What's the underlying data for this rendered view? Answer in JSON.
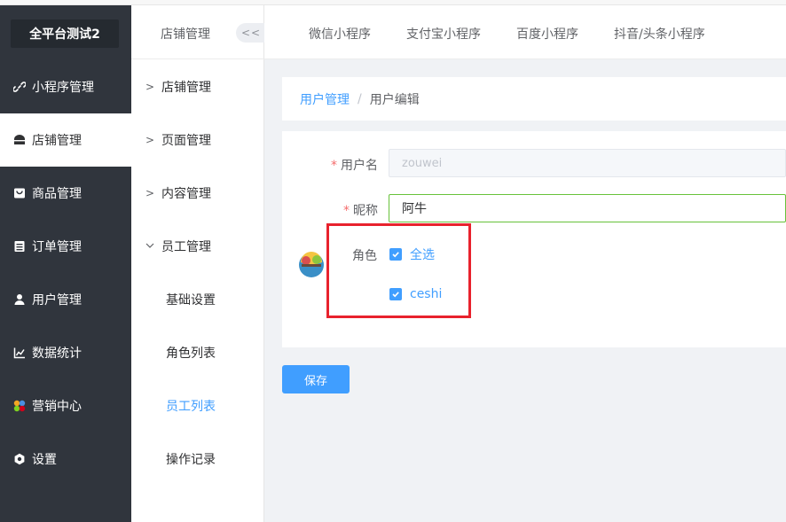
{
  "sidebar": {
    "brand": "全平台测试2",
    "items": [
      {
        "label": "小程序管理",
        "icon": "link-icon"
      },
      {
        "label": "店铺管理",
        "icon": "shop-icon"
      },
      {
        "label": "商品管理",
        "icon": "goods-icon"
      },
      {
        "label": "订单管理",
        "icon": "order-icon"
      },
      {
        "label": "用户管理",
        "icon": "user-icon"
      },
      {
        "label": "数据统计",
        "icon": "chart-icon"
      },
      {
        "label": "营销中心",
        "icon": "marketing-icon"
      },
      {
        "label": "设置",
        "icon": "settings-icon"
      }
    ],
    "active_index": 1
  },
  "subnav": {
    "title": "店铺管理",
    "collapse_label": "<<",
    "items": [
      {
        "label": "店铺管理"
      },
      {
        "label": "页面管理"
      },
      {
        "label": "内容管理"
      },
      {
        "label": "员工管理"
      },
      {
        "label": "基础设置"
      },
      {
        "label": "角色列表"
      },
      {
        "label": "员工列表"
      },
      {
        "label": "操作记录"
      }
    ]
  },
  "topbar": {
    "tabs": [
      "微信小程序",
      "支付宝小程序",
      "百度小程序",
      "抖音/头条小程序"
    ]
  },
  "breadcrumb": {
    "parent": "用户管理",
    "separator": "/",
    "current": "用户编辑"
  },
  "form": {
    "username_label": "用户名",
    "username_value": "zouwei",
    "nickname_label": "昵称",
    "nickname_value": "阿牛",
    "role_label": "角色",
    "roles": [
      {
        "label": "全选",
        "checked": true
      },
      {
        "label": "ceshi",
        "checked": true
      }
    ],
    "required_mark": "*"
  },
  "actions": {
    "save_label": "保存"
  },
  "colors": {
    "sidebar_bg": "#30353d",
    "accent": "#409eff",
    "highlight_box": "#e8222d",
    "focus_border": "#67c23a"
  }
}
